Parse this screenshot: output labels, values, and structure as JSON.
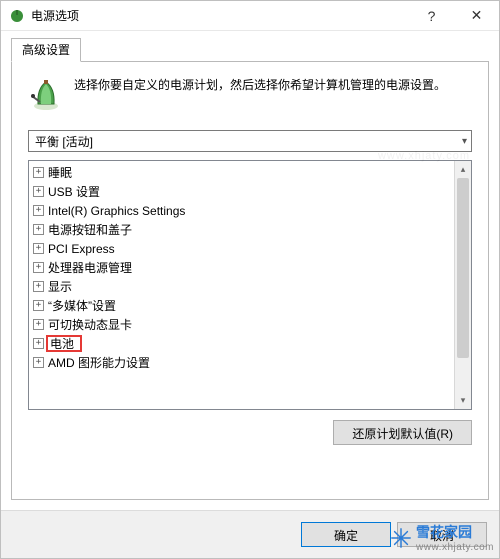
{
  "window": {
    "title": "电源选项",
    "help_glyph": "?",
    "close_glyph": "✕"
  },
  "tabs": {
    "active": "高级设置"
  },
  "intro": {
    "text": "选择你要自定义的电源计划，然后选择你希望计算机管理的电源设置。"
  },
  "plan_select": {
    "value": "平衡 [活动]"
  },
  "tree": {
    "items": [
      {
        "label": "睡眠",
        "highlight": false
      },
      {
        "label": "USB 设置",
        "highlight": false
      },
      {
        "label": "Intel(R) Graphics Settings",
        "highlight": false
      },
      {
        "label": "电源按钮和盖子",
        "highlight": false
      },
      {
        "label": "PCI Express",
        "highlight": false
      },
      {
        "label": "处理器电源管理",
        "highlight": false
      },
      {
        "label": "显示",
        "highlight": false
      },
      {
        "label": "“多媒体”设置",
        "highlight": false
      },
      {
        "label": "可切换动态显卡",
        "highlight": false
      },
      {
        "label": "电池",
        "highlight": true
      },
      {
        "label": "AMD 图形能力设置",
        "highlight": false
      }
    ]
  },
  "buttons": {
    "restore_defaults": "还原计划默认值(R)",
    "ok": "确定",
    "cancel": "取消"
  },
  "watermark": {
    "brand": "雪花家园",
    "url": "www.xhjaty.com"
  }
}
